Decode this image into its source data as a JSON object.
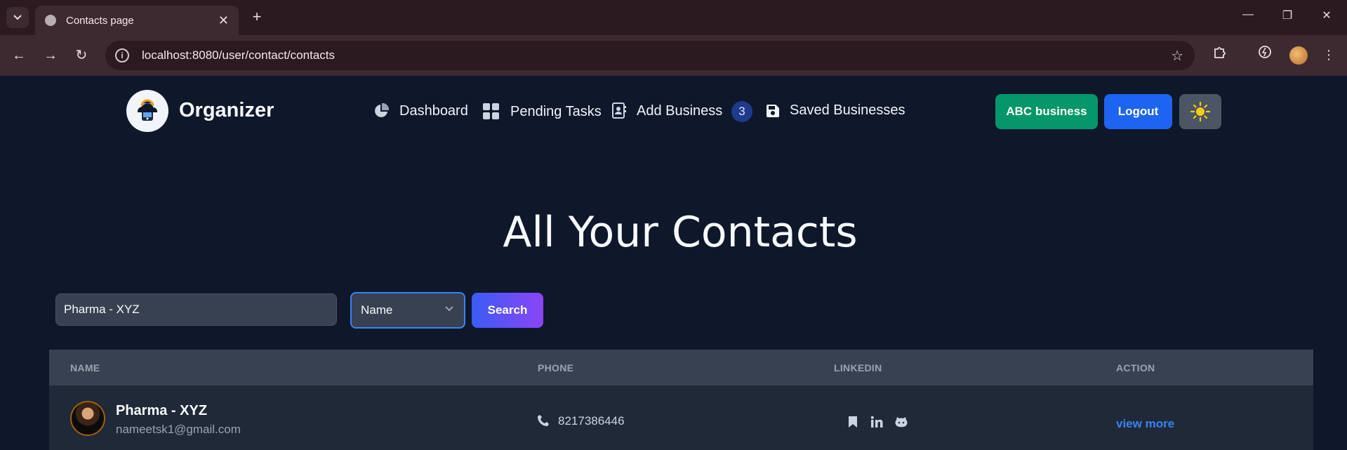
{
  "browser": {
    "tab_title": "Contacts page",
    "url": "localhost:8080/user/contact/contacts"
  },
  "app": {
    "brand": "Organizer",
    "nav": [
      {
        "label": "Dashboard",
        "icon": "pie-chart-icon"
      },
      {
        "label": "Pending Tasks",
        "icon": "grid-icon"
      },
      {
        "label": "Add Business",
        "icon": "contact-book-icon"
      },
      {
        "label": "Saved Businesses",
        "icon": "floppy-disk-icon"
      }
    ],
    "badge_count": "3",
    "business_button": "ABC business",
    "logout_button": "Logout",
    "theme_icon": "sun-icon"
  },
  "page": {
    "title": "All Your Contacts",
    "search_value": "Pharma - XYZ",
    "search_field_selected": "Name",
    "search_button": "Search"
  },
  "table": {
    "columns": [
      "NAME",
      "PHONE",
      "LINKEDIN",
      "ACTION"
    ],
    "rows": [
      {
        "name": "Pharma - XYZ",
        "email": "nameetsk1@gmail.com",
        "phone": "8217386446",
        "social_icons": [
          "bookmark-icon",
          "linkedin-icon",
          "github-icon"
        ],
        "action": "view more"
      }
    ]
  },
  "colors": {
    "background": "#0f172a",
    "green_button": "#059669",
    "blue_button": "#1d64f0",
    "link": "#3b82f6"
  }
}
